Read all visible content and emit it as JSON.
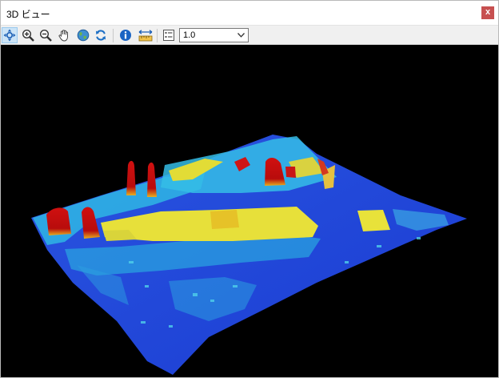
{
  "window": {
    "title": "3D ビュー",
    "close_label": "x"
  },
  "toolbar": {
    "buttons": [
      {
        "name": "navigate-button",
        "icon": "navigate-icon",
        "active": true
      },
      {
        "name": "zoom-in-button",
        "icon": "zoom-in-icon"
      },
      {
        "name": "zoom-out-button",
        "icon": "zoom-out-icon"
      },
      {
        "name": "pan-button",
        "icon": "hand-icon"
      },
      {
        "name": "full-extent-button",
        "icon": "globe-icon"
      },
      {
        "name": "refresh-button",
        "icon": "refresh-icon"
      },
      {
        "name": "identify-button",
        "icon": "info-icon"
      },
      {
        "name": "measure-button",
        "icon": "ruler-icon"
      },
      {
        "name": "settings-button",
        "icon": "settings-list-icon"
      }
    ],
    "exaggeration": {
      "value": "1.0"
    }
  },
  "viewport": {
    "content": "3d-terrain-elevation-render",
    "colors": {
      "low": "#1e3fd7",
      "mid": "#33c7e6",
      "high": "#e8e23a",
      "peak": "#d21414"
    }
  }
}
